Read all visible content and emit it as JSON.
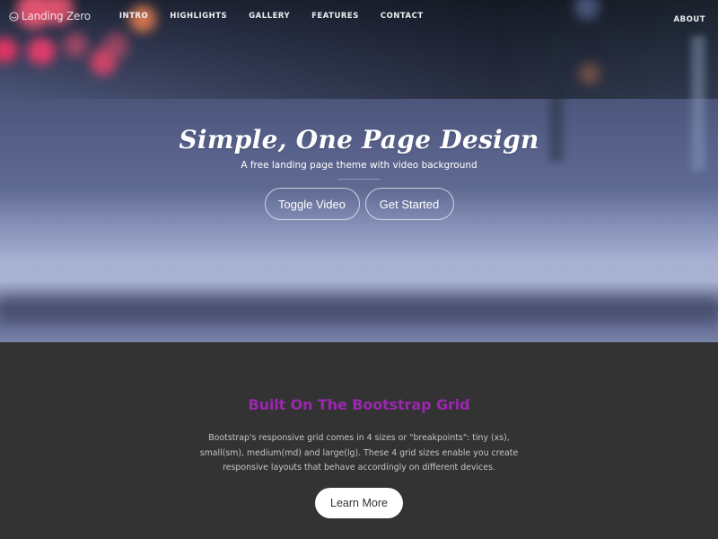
{
  "navbar": {
    "brand": {
      "icon": "smile-circle-icon",
      "label": "Landing Zero"
    },
    "links": [
      {
        "label": "INTRO"
      },
      {
        "label": "HIGHLIGHTS"
      },
      {
        "label": "GALLERY"
      },
      {
        "label": "FEATURES"
      },
      {
        "label": "CONTACT"
      }
    ],
    "right_links": [
      {
        "label": "ABOUT"
      }
    ]
  },
  "hero": {
    "title": "Simple, One Page Design",
    "subtitle": "A free landing page theme with video background",
    "buttons": [
      {
        "label": "Toggle Video"
      },
      {
        "label": "Get Started"
      }
    ]
  },
  "section": {
    "title": "Built On The Bootstrap Grid",
    "title_color": "#9b27b0",
    "text": "Bootstrap's responsive grid comes in 4 sizes or \"breakpoints\": tiny (xs), small(sm), medium(md) and large(lg). These 4 grid sizes enable you create responsive layouts that behave accordingly on different devices.",
    "button_label": "Learn More"
  }
}
